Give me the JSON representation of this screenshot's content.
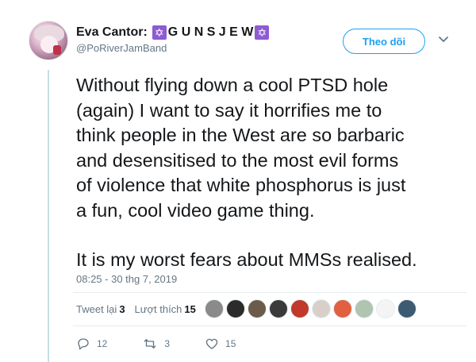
{
  "author": {
    "name_prefix": "Eva Cantor:",
    "name_middle": "G U N S J E W",
    "star_glyph": "✡",
    "handle": "@PoRiverJamBand",
    "avatar_icon": "anime-avatar"
  },
  "follow_button": {
    "label": "Theo dõi"
  },
  "tweet": {
    "lines_p1": [
      "Without flying down a cool PTSD hole",
      "(again) I want to say it horrifies me to",
      "think people in the West are so barbaric",
      "and desensitised to the most evil forms",
      "of violence that white phosphorus is just",
      "a fun, cool video game thing."
    ],
    "line_p2": "It is my worst fears about MMSs realised."
  },
  "timestamp": "08:25 - 30 thg 7, 2019",
  "stats": {
    "retweets_label": "Tweet lại",
    "retweets_count": "3",
    "likes_label": "Lượt thích",
    "likes_count": "15"
  },
  "likers": [
    {
      "color": "#8a8a8a"
    },
    {
      "color": "#2b2b2b"
    },
    {
      "color": "#6b5b4b"
    },
    {
      "color": "#3a3a3a"
    },
    {
      "color": "#c0392b"
    },
    {
      "color": "#d8d0c8"
    },
    {
      "color": "#e06040"
    },
    {
      "color": "#b0c4b0"
    },
    {
      "color": "#f4f4f4"
    },
    {
      "color": "#3d5a73"
    }
  ],
  "actions": {
    "reply_count": "12",
    "retweet_count": "3",
    "like_count": "15"
  },
  "colors": {
    "accent": "#1da1f2",
    "secondary_text": "#657786",
    "star_bg": "#8e5bd3"
  }
}
